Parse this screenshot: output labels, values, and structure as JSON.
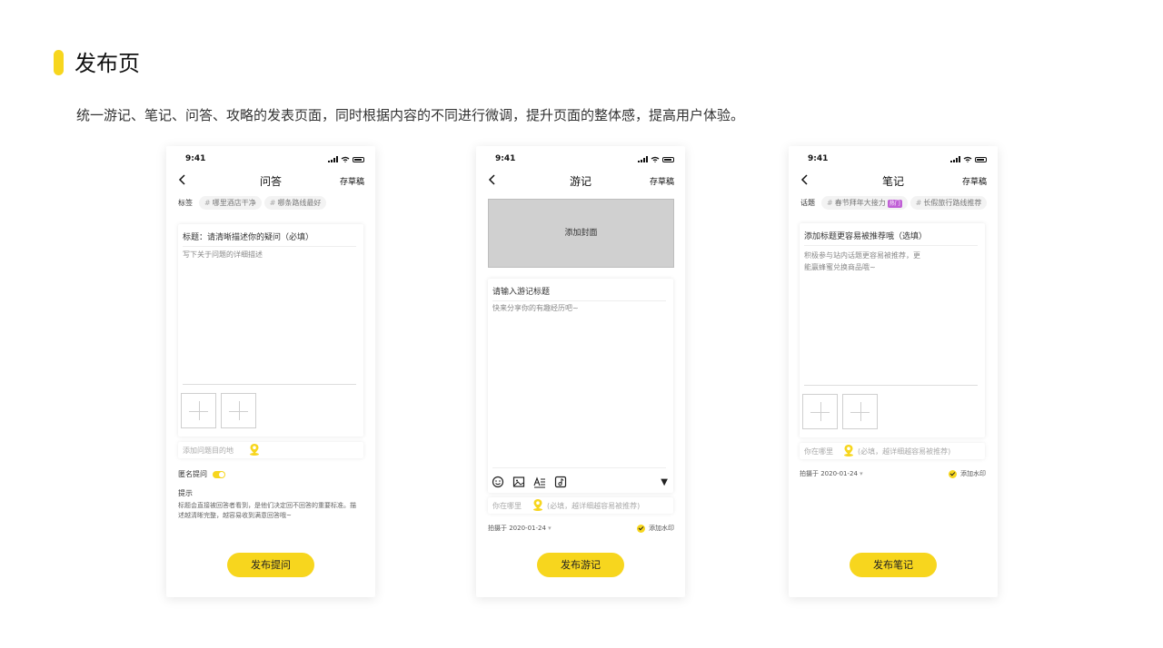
{
  "header": {
    "title": "发布页",
    "description": "统一游记、笔记、问答、攻略的发表页面，同时根据内容的不同进行微调，提升页面的整体感，提高用户体验。",
    "accent_color": "#f7d61e"
  },
  "phones": [
    {
      "time": "9:41",
      "nav_title": "问答",
      "draft_label": "存草稿",
      "tags_label": "标签",
      "tags": [
        "哪里酒店干净",
        "哪条路线最好"
      ],
      "title_placeholder": "标题：请清晰描述你的疑问（必填）",
      "body_placeholder": "写下关于问题的详细描述",
      "location_placeholder": "添加问题目的地",
      "anonymous_label": "匿名提问",
      "anonymous_on": true,
      "tips_title": "提示",
      "tips_body": "标题会直接被回答者看到，是他们决定回不回答的重要标准。描述越清晰完整，越容易收到满意回答哦~",
      "publish_label": "发布提问"
    },
    {
      "time": "9:41",
      "nav_title": "游记",
      "draft_label": "存草稿",
      "cover_label": "添加封面",
      "title_placeholder": "请输入游记标题",
      "body_placeholder": "快来分享你的有趣经历吧~",
      "toolbar_icons": [
        "emoji-icon",
        "image-icon",
        "text-format-icon",
        "music-icon"
      ],
      "location_label": "你在哪里",
      "location_placeholder": "(必填，越详细越容易被推荐)",
      "date_label": "拍摄于 2020-01-24",
      "watermark_label": "添加水印",
      "publish_label": "发布游记"
    },
    {
      "time": "9:41",
      "nav_title": "笔记",
      "draft_label": "存草稿",
      "tags_label": "话题",
      "tags": [
        "春节拜年大接力",
        "长假旅行路线推荐"
      ],
      "hot_badge": "热门",
      "title_placeholder": "添加标题更容易被推荐哦（选填）",
      "body_placeholder": "积极参与站内话题更容易被推荐，更能赢蜂蜜兑换商品哦~",
      "location_label": "你在哪里",
      "location_placeholder": "(必填，越详细越容易被推荐)",
      "date_label": "拍摄于 2020-01-24",
      "watermark_label": "添加水印",
      "publish_label": "发布笔记"
    }
  ]
}
